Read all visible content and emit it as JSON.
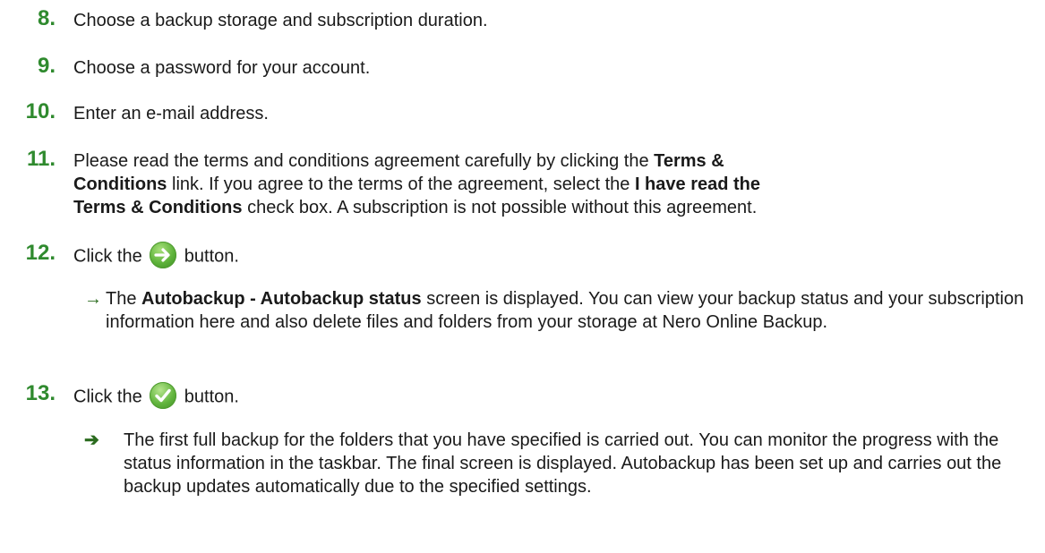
{
  "steps": [
    {
      "number": "8.",
      "text": "Choose a backup storage and subscription duration."
    },
    {
      "number": "9.",
      "text": "Choose a password for your account."
    },
    {
      "number": "10.",
      "text": "Enter an e-mail address."
    },
    {
      "number": "11.",
      "text_a": "Please read the terms and conditions agreement carefully by clicking the ",
      "bold_a": "Terms &",
      "text_b": "",
      "bold_b": "Conditions",
      "text_c": " link. If you agree to the terms of the agreement, select the ",
      "bold_c": "I have read the",
      "bold_d": "Terms & Conditions",
      "text_d": " check box. A subscription is not possible without this agreement."
    },
    {
      "number": "12.",
      "text_a": "Click the ",
      "text_b": " button.",
      "icon": "next-arrow-icon"
    },
    {
      "number": "13.",
      "text_a": "Click the ",
      "text_b": " button.",
      "icon": "checkmark-icon"
    }
  ],
  "results": [
    {
      "arrow": "→",
      "text_a": "The ",
      "bold": "Autobackup - Autobackup status",
      "text_b": " screen is displayed. You can view your backup status and your subscription information here and also delete files and folders from your storage at Nero Online Backup."
    },
    {
      "arrow": "➔",
      "text": "The first full backup for the folders that you have specified is carried out. You can monitor the progress with the status information in the taskbar. The final screen is displayed. Autobackup has been set up and carries out the backup updates automatically due to the specified settings."
    }
  ],
  "colors": {
    "step_number": "#2f8a2e",
    "text": "#1a1a1a",
    "arrow": "#2a6b1e",
    "icon_green": "#5db23a"
  }
}
